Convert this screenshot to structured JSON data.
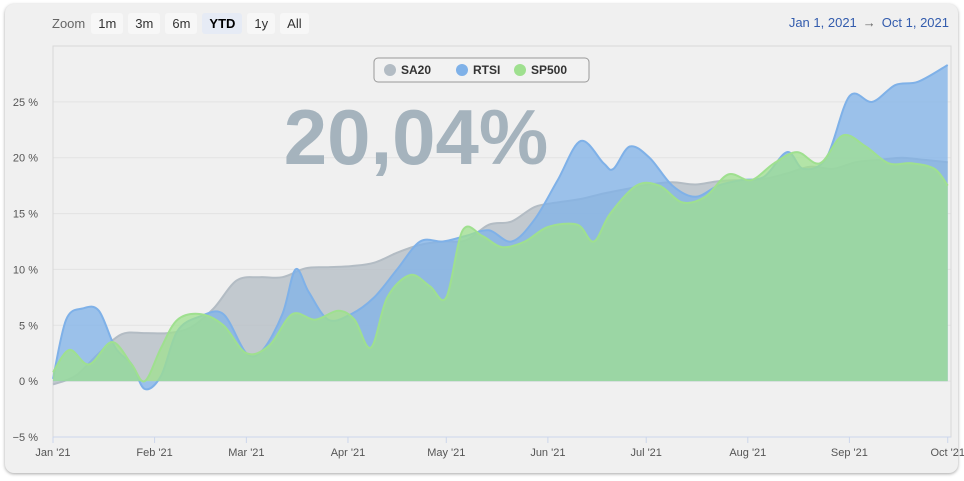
{
  "range_selector": {
    "zoom_label": "Zoom",
    "buttons": [
      "1m",
      "3m",
      "6m",
      "YTD",
      "1y",
      "All"
    ],
    "selected": "YTD",
    "from": "Jan 1, 2021",
    "arrow": "→",
    "to": "Oct 1, 2021"
  },
  "big_value": "20,04%",
  "chart_data": {
    "type": "area",
    "x_label": "",
    "y_label": "",
    "x_ticks": [
      "Jan '21",
      "Feb '21",
      "Mar '21",
      "Apr '21",
      "May '21",
      "Jun '21",
      "Jul '21",
      "Aug '21",
      "Sep '21",
      "Oct '21"
    ],
    "y_ticks": [
      "−5 %",
      "0 %",
      "5 %",
      "10 %",
      "15 %",
      "20 %",
      "25 %"
    ],
    "ylim": [
      -5,
      30
    ],
    "xlim": [
      "2021-01-01",
      "2021-10-02"
    ],
    "grid": true,
    "legend_position": "top-center",
    "series": [
      {
        "name": "SA20",
        "color": "#b3bcc4",
        "points": [
          [
            "2021-01-01",
            -0.3
          ],
          [
            "2021-01-08",
            0.5
          ],
          [
            "2021-01-15",
            2.5
          ],
          [
            "2021-01-22",
            4.2
          ],
          [
            "2021-01-29",
            4.3
          ],
          [
            "2021-02-05",
            4.3
          ],
          [
            "2021-02-12",
            4.8
          ],
          [
            "2021-02-19",
            6.5
          ],
          [
            "2021-02-26",
            9.0
          ],
          [
            "2021-03-05",
            9.3
          ],
          [
            "2021-03-12",
            9.3
          ],
          [
            "2021-03-19",
            10.1
          ],
          [
            "2021-03-26",
            10.2
          ],
          [
            "2021-04-02",
            10.3
          ],
          [
            "2021-04-09",
            10.6
          ],
          [
            "2021-04-16",
            11.5
          ],
          [
            "2021-04-23",
            12.2
          ],
          [
            "2021-04-30",
            12.5
          ],
          [
            "2021-05-07",
            12.6
          ],
          [
            "2021-05-14",
            14.0
          ],
          [
            "2021-05-21",
            14.3
          ],
          [
            "2021-05-28",
            15.6
          ],
          [
            "2021-06-04",
            16.0
          ],
          [
            "2021-06-11",
            16.3
          ],
          [
            "2021-06-18",
            16.8
          ],
          [
            "2021-06-25",
            17.2
          ],
          [
            "2021-07-02",
            17.6
          ],
          [
            "2021-07-09",
            17.8
          ],
          [
            "2021-07-16",
            17.6
          ],
          [
            "2021-07-23",
            17.9
          ],
          [
            "2021-07-30",
            18.0
          ],
          [
            "2021-08-06",
            18.1
          ],
          [
            "2021-08-13",
            18.6
          ],
          [
            "2021-08-20",
            19.2
          ],
          [
            "2021-08-27",
            19.0
          ],
          [
            "2021-09-03",
            19.6
          ],
          [
            "2021-09-10",
            19.8
          ],
          [
            "2021-09-17",
            20.0
          ],
          [
            "2021-09-24",
            19.8
          ],
          [
            "2021-10-01",
            19.6
          ]
        ]
      },
      {
        "name": "RTSI",
        "color": "#7fb1e8",
        "points": [
          [
            "2021-01-01",
            0.2
          ],
          [
            "2021-01-05",
            5.5
          ],
          [
            "2021-01-10",
            6.5
          ],
          [
            "2021-01-15",
            6.3
          ],
          [
            "2021-01-20",
            3.0
          ],
          [
            "2021-01-25",
            1.5
          ],
          [
            "2021-01-29",
            -0.7
          ],
          [
            "2021-02-03",
            0.5
          ],
          [
            "2021-02-08",
            4.5
          ],
          [
            "2021-02-15",
            5.8
          ],
          [
            "2021-02-22",
            6.0
          ],
          [
            "2021-03-01",
            2.5
          ],
          [
            "2021-03-06",
            2.8
          ],
          [
            "2021-03-12",
            6.0
          ],
          [
            "2021-03-16",
            10.0
          ],
          [
            "2021-03-20",
            8.0
          ],
          [
            "2021-03-26",
            5.5
          ],
          [
            "2021-04-02",
            6.0
          ],
          [
            "2021-04-09",
            7.5
          ],
          [
            "2021-04-16",
            10.0
          ],
          [
            "2021-04-23",
            12.5
          ],
          [
            "2021-04-30",
            12.5
          ],
          [
            "2021-05-07",
            13.0
          ],
          [
            "2021-05-14",
            13.5
          ],
          [
            "2021-05-21",
            12.5
          ],
          [
            "2021-05-28",
            14.5
          ],
          [
            "2021-06-04",
            18.0
          ],
          [
            "2021-06-11",
            21.5
          ],
          [
            "2021-06-18",
            19.5
          ],
          [
            "2021-06-21",
            19.0
          ],
          [
            "2021-06-26",
            21.0
          ],
          [
            "2021-07-02",
            20.0
          ],
          [
            "2021-07-09",
            17.5
          ],
          [
            "2021-07-16",
            16.5
          ],
          [
            "2021-07-23",
            17.5
          ],
          [
            "2021-07-30",
            18.0
          ],
          [
            "2021-08-06",
            18.3
          ],
          [
            "2021-08-13",
            20.5
          ],
          [
            "2021-08-18",
            19.0
          ],
          [
            "2021-08-25",
            20.0
          ],
          [
            "2021-09-01",
            25.5
          ],
          [
            "2021-09-08",
            25.0
          ],
          [
            "2021-09-15",
            26.5
          ],
          [
            "2021-09-22",
            26.8
          ],
          [
            "2021-10-01",
            28.3
          ]
        ]
      },
      {
        "name": "SP500",
        "color": "#9fe08f",
        "points": [
          [
            "2021-01-01",
            0.8
          ],
          [
            "2021-01-06",
            2.8
          ],
          [
            "2021-01-12",
            1.5
          ],
          [
            "2021-01-19",
            3.5
          ],
          [
            "2021-01-25",
            1.5
          ],
          [
            "2021-01-29",
            0.0
          ],
          [
            "2021-02-03",
            3.0
          ],
          [
            "2021-02-08",
            5.5
          ],
          [
            "2021-02-15",
            6.0
          ],
          [
            "2021-02-22",
            5.0
          ],
          [
            "2021-03-01",
            2.5
          ],
          [
            "2021-03-08",
            3.2
          ],
          [
            "2021-03-15",
            6.0
          ],
          [
            "2021-03-22",
            5.5
          ],
          [
            "2021-03-29",
            6.3
          ],
          [
            "2021-04-03",
            5.5
          ],
          [
            "2021-04-08",
            3.0
          ],
          [
            "2021-04-13",
            7.5
          ],
          [
            "2021-04-20",
            9.5
          ],
          [
            "2021-04-26",
            8.5
          ],
          [
            "2021-05-01",
            7.5
          ],
          [
            "2021-05-06",
            13.5
          ],
          [
            "2021-05-12",
            13.0
          ],
          [
            "2021-05-18",
            12.0
          ],
          [
            "2021-05-25",
            12.5
          ],
          [
            "2021-06-01",
            13.8
          ],
          [
            "2021-06-10",
            14.0
          ],
          [
            "2021-06-15",
            12.5
          ],
          [
            "2021-06-20",
            15.0
          ],
          [
            "2021-06-28",
            17.5
          ],
          [
            "2021-07-05",
            17.5
          ],
          [
            "2021-07-12",
            16.0
          ],
          [
            "2021-07-19",
            16.5
          ],
          [
            "2021-07-26",
            18.5
          ],
          [
            "2021-08-02",
            18.0
          ],
          [
            "2021-08-09",
            19.5
          ],
          [
            "2021-08-16",
            20.5
          ],
          [
            "2021-08-23",
            19.5
          ],
          [
            "2021-08-30",
            22.0
          ],
          [
            "2021-09-06",
            21.0
          ],
          [
            "2021-09-13",
            19.5
          ],
          [
            "2021-09-20",
            19.5
          ],
          [
            "2021-09-27",
            19.0
          ],
          [
            "2021-10-01",
            17.5
          ]
        ]
      }
    ]
  },
  "colors": {
    "SA20": "#b3bcc4",
    "RTSI": "#7fb1e8",
    "SP500": "#9fe08f",
    "range_text": "#335cad",
    "big_value": "#a5b3bd"
  }
}
